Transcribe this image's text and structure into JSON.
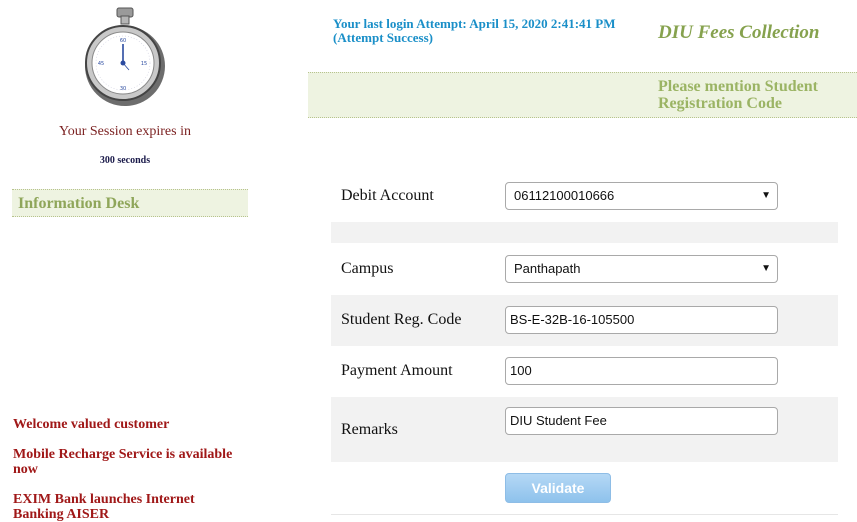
{
  "session": {
    "expires_label": "Your Session expires in",
    "seconds_label": "300 seconds",
    "timer_icon": "stopwatch-icon"
  },
  "sidebar": {
    "info_desk_title": "Information Desk",
    "news": [
      "Welcome valued customer",
      "Mobile Recharge Service is available now",
      "EXIM Bank launches Internet Banking AISER"
    ]
  },
  "header": {
    "login_status": "Your last login Attempt: April 15, 2020 2:41:41 PM (Attempt Success)",
    "app_title": "DIU Fees Collection",
    "instruction": "Please mention Student Registration Code"
  },
  "form": {
    "debit_account": {
      "label": "Debit Account",
      "value": "06112100010666"
    },
    "campus": {
      "label": "Campus",
      "value": "Panthapath"
    },
    "student_reg_code": {
      "label": "Student Reg. Code",
      "value": "BS-E-32B-16-105500"
    },
    "payment_amount": {
      "label": "Payment Amount",
      "value": "100"
    },
    "remarks": {
      "label": "Remarks",
      "value": "DIU Student Fee"
    },
    "validate_label": "Validate"
  },
  "colors": {
    "accent_green": "#86a24e",
    "banner_bg": "#eef3e1",
    "login_blue": "#1a8fc8",
    "news_red": "#a01818",
    "button_blue": "#8ec2ec"
  }
}
